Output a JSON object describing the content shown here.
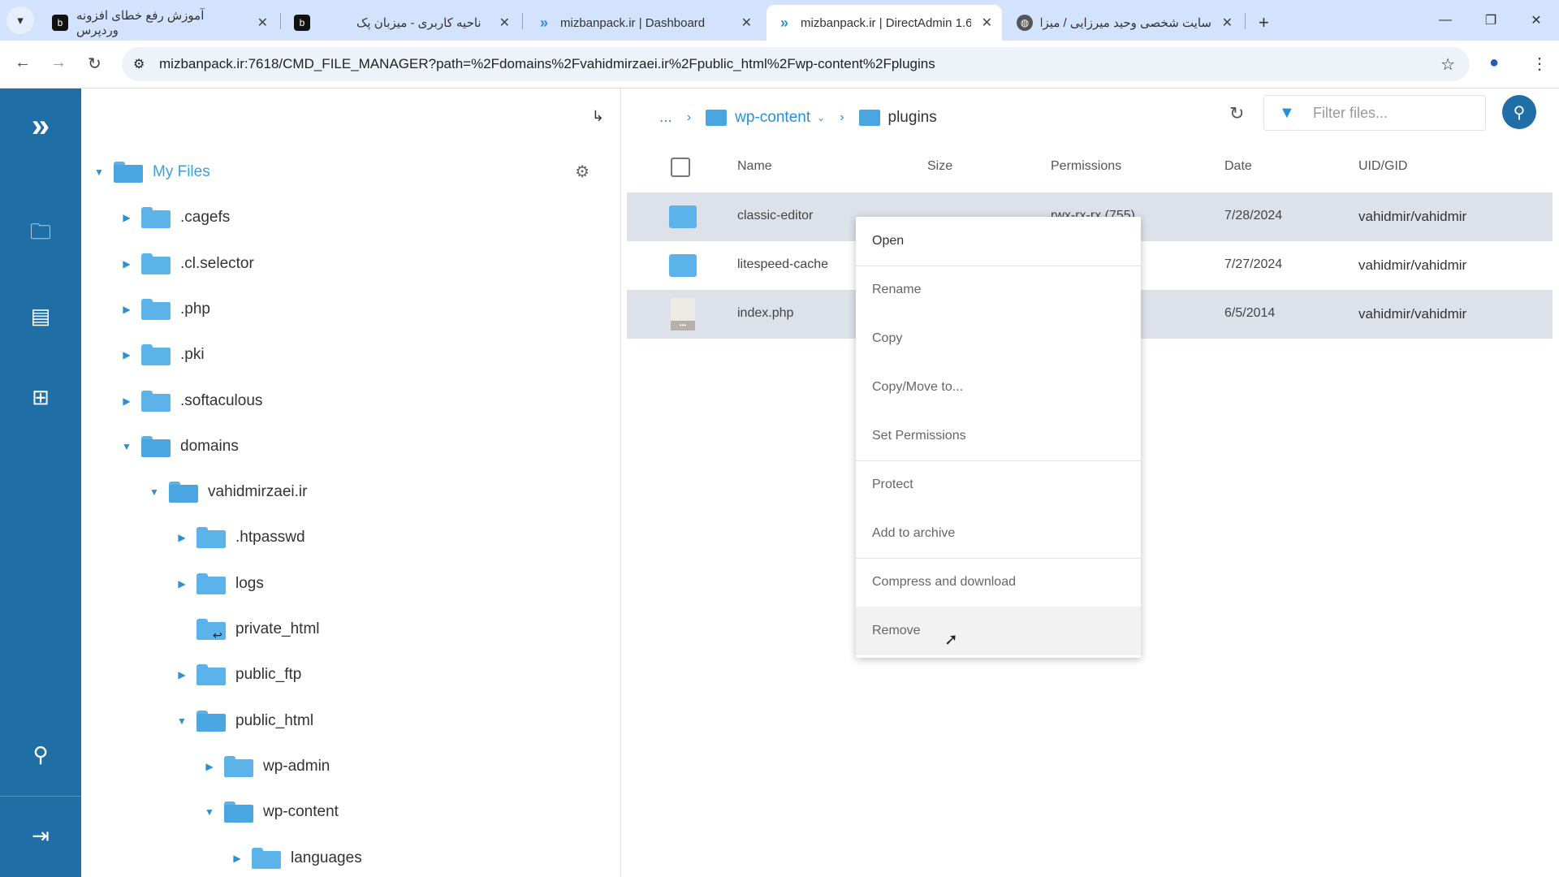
{
  "browser": {
    "tabs": [
      {
        "title": "آموزش رفع خطای افزونه وردپرس",
        "icon": "site-icon"
      },
      {
        "title": "ناحیه کاربری - میزبان پک",
        "icon": "site-icon"
      },
      {
        "title": "mizbanpack.ir | Dashboard",
        "icon": "directadmin-icon"
      },
      {
        "title": "mizbanpack.ir | DirectAdmin 1.6",
        "icon": "directadmin-icon",
        "active": true
      },
      {
        "title": "سایت شخصی وحید میرزایی / میزا",
        "icon": "globe-icon"
      }
    ],
    "url": "mizbanpack.ir:7618/CMD_FILE_MANAGER?path=%2Fdomains%2Fvahidmirzaei.ir%2Fpublic_html%2Fwp-content%2Fplugins"
  },
  "tree": {
    "items": [
      {
        "label": "My Files",
        "level": 0,
        "state": "open"
      },
      {
        "label": ".cagefs",
        "level": 1,
        "state": "closed"
      },
      {
        "label": ".cl.selector",
        "level": 1,
        "state": "closed"
      },
      {
        "label": ".php",
        "level": 1,
        "state": "closed"
      },
      {
        "label": ".pki",
        "level": 1,
        "state": "closed"
      },
      {
        "label": ".softaculous",
        "level": 1,
        "state": "closed"
      },
      {
        "label": "domains",
        "level": 1,
        "state": "open"
      },
      {
        "label": "vahidmirzaei.ir",
        "level": 2,
        "state": "open"
      },
      {
        "label": ".htpasswd",
        "level": 3,
        "state": "closed"
      },
      {
        "label": "logs",
        "level": 3,
        "state": "closed"
      },
      {
        "label": "private_html",
        "level": 3,
        "state": "link"
      },
      {
        "label": "public_ftp",
        "level": 3,
        "state": "closed"
      },
      {
        "label": "public_html",
        "level": 3,
        "state": "open"
      },
      {
        "label": "wp-admin",
        "level": 4,
        "state": "closed"
      },
      {
        "label": "wp-content",
        "level": 4,
        "state": "open"
      },
      {
        "label": "languages",
        "level": 5,
        "state": "closed"
      }
    ]
  },
  "breadcrumb": {
    "ellipsis": "...",
    "parent": "wp-content",
    "current": "plugins"
  },
  "filter": {
    "placeholder": "Filter files..."
  },
  "table": {
    "headers": {
      "name": "Name",
      "size": "Size",
      "permissions": "Permissions",
      "date": "Date",
      "uid": "UID/GID"
    },
    "rows": [
      {
        "name": "classic-editor",
        "size": "",
        "permissions": "rwx-rx-rx (755)",
        "date": "7/28/2024",
        "uid": "vahidmir/vahidmir",
        "type": "folder",
        "selected": true
      },
      {
        "name": "litespeed-cache",
        "size": "",
        "permissions": "",
        "date": "7/27/2024",
        "uid": "vahidmir/vahidmir",
        "type": "folder",
        "selected": false
      },
      {
        "name": "index.php",
        "size": "",
        "permissions": "",
        "date": "6/5/2014",
        "uid": "vahidmir/vahidmir",
        "type": "file",
        "selected": true
      }
    ]
  },
  "context_menu": [
    "Open",
    "Rename",
    "Copy",
    "Copy/Move to...",
    "Set Permissions",
    "Protect",
    "Add to archive",
    "Compress and download",
    "Remove"
  ],
  "colors": {
    "sidebar": "#1f6ea6",
    "accent": "#2a8fd4",
    "folder": "#5cb3ea",
    "selected_row": "#dde1e9"
  }
}
